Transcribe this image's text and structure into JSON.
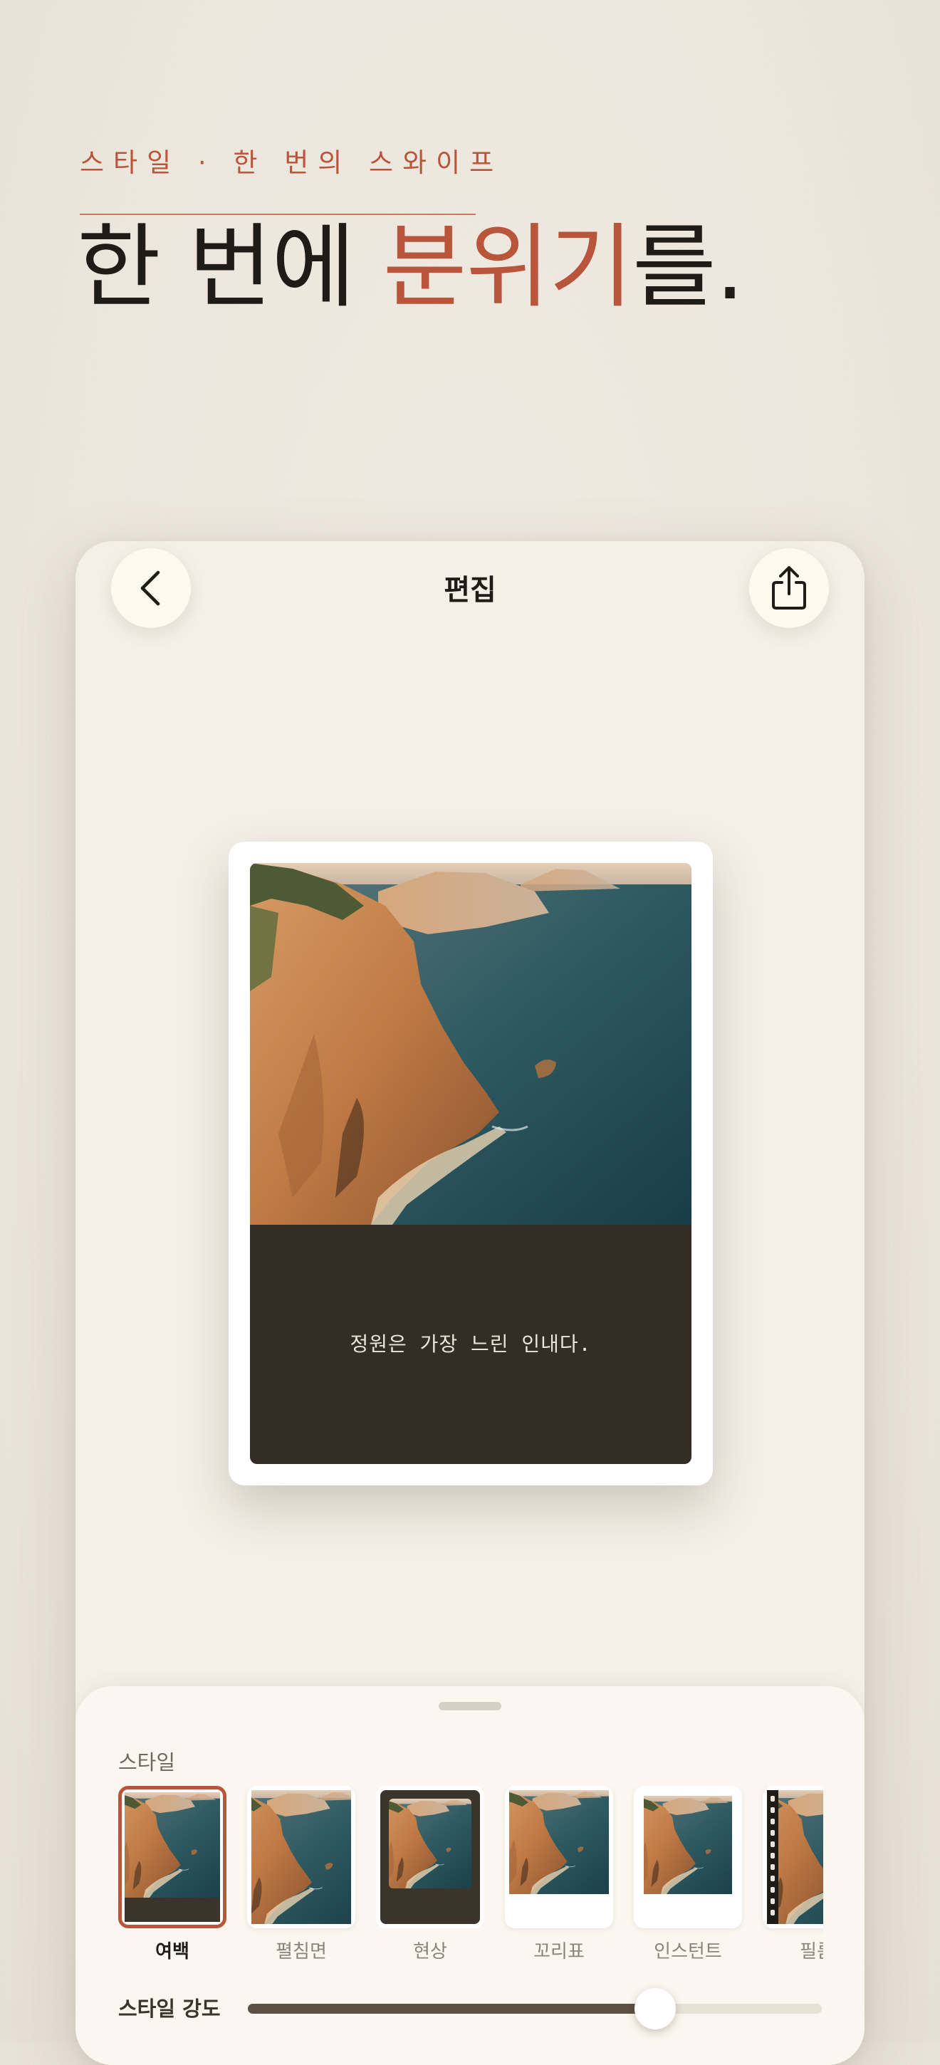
{
  "hero": {
    "eyebrow": "스타일 · 한 번의 스와이프",
    "headline_before": "한 번에 ",
    "headline_accent": "분위기",
    "headline_after": "를."
  },
  "colors": {
    "accent": "#b8553a",
    "ink": "#1f1b17",
    "card_caption_bg": "#332d25",
    "phone_bg": "#f4f0e7",
    "sheet_bg": "#fbf7f0"
  },
  "editor": {
    "title": "편집",
    "back_icon": "chevron-left-icon",
    "share_icon": "share-icon"
  },
  "card": {
    "caption": "정원은 가장 느린 인내다."
  },
  "sheet": {
    "style_label": "스타일",
    "styles": [
      {
        "name": "여백",
        "selected": true
      },
      {
        "name": "펼침면",
        "selected": false
      },
      {
        "name": "현상",
        "selected": false
      },
      {
        "name": "꼬리표",
        "selected": false
      },
      {
        "name": "인스턴트",
        "selected": false
      },
      {
        "name": "필름",
        "selected": false
      }
    ],
    "intensity_label": "스타일 강도",
    "intensity_value": 0.71
  }
}
